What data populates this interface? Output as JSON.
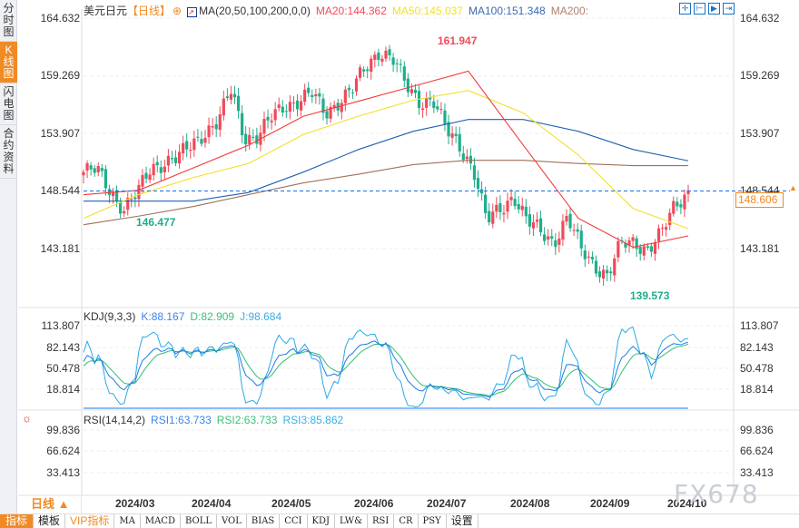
{
  "sidebar": {
    "tabs": [
      "分时图",
      "K线图",
      "闪电图",
      "合约资料"
    ],
    "active": 1
  },
  "header": {
    "symbol": "美元日元",
    "period_tag": "【日线】",
    "ma_label": "MA(20,50,100,200,0,0)",
    "ma20": "MA20:144.362",
    "ma50": "MA50:145.037",
    "ma100": "MA100:151.348",
    "ma200": "MA200:"
  },
  "colors": {
    "up": "#f04a5a",
    "down": "#1fae8a",
    "ma20": "#f03a3a",
    "ma50": "#f2e02a",
    "ma100": "#2060b0",
    "ma200": "#a0705a",
    "k": "#1e7be6",
    "d": "#2fbf71",
    "j": "#2aa8e6",
    "accent": "#f08a24"
  },
  "price_axis": [
    "164.632",
    "159.269",
    "153.907",
    "148.544",
    "143.181"
  ],
  "current_price": "148.606",
  "annotations": {
    "high": "161.947",
    "low_left": "146.477",
    "low_right": "139.573"
  },
  "kdj": {
    "label": "KDJ(9,3,3)",
    "k": "K:88.167",
    "d": "D:82.909",
    "j": "J:98.684",
    "axis": [
      "113.807",
      "82.143",
      "50.478",
      "18.814"
    ]
  },
  "rsi": {
    "label": "RSI(14,14,2)",
    "rsi1": "RSI1:63.733",
    "rsi2": "RSI2:63.733",
    "rsi3": "RSI3:85.862",
    "axis": [
      "99.836",
      "66.624",
      "33.413"
    ]
  },
  "period": "日线 ▲",
  "dates": [
    "2024/03",
    "2024/04",
    "2024/05",
    "2024/06",
    "2024/07",
    "2024/08",
    "2024/09",
    "2024/10"
  ],
  "tabs": [
    "指标",
    "模板",
    "VIP指标",
    "MA",
    "MACD",
    "BOLL",
    "VOL",
    "BIAS",
    "CCI",
    "KDJ",
    "LW&",
    "RSI",
    "CR",
    "PSY",
    "设置"
  ],
  "watermark": "FX678",
  "chart_data": {
    "type": "candlestick",
    "ylim": [
      139.0,
      165.5
    ],
    "close_samples": [
      150.3,
      150.4,
      148.6,
      146.9,
      148.2,
      150.7,
      151.3,
      151.5,
      152.8,
      154.1,
      154.9,
      157.9,
      153.6,
      153.6,
      155.3,
      156.6,
      157.0,
      157.5,
      155.8,
      157.0,
      157.9,
      160.0,
      161.7,
      160.8,
      158.3,
      157.0,
      157.0,
      154.1,
      152.8,
      150.7,
      145.6,
      146.9,
      148.2,
      145.6,
      144.8,
      143.9,
      146.0,
      143.1,
      141.8,
      140.6,
      143.5,
      143.9,
      143.1,
      144.4,
      147.3,
      148.6
    ],
    "ma20": [
      148.2,
      148.6,
      150.7,
      152.8,
      155.5,
      156.9,
      158.3,
      159.7,
      152.8,
      146.0,
      143.3,
      144.36
    ],
    "ma50": [
      146.0,
      148.2,
      149.8,
      151.1,
      153.8,
      155.5,
      157.0,
      157.9,
      155.8,
      151.9,
      146.9,
      145.04
    ],
    "ma100": [
      147.6,
      147.6,
      147.6,
      148.4,
      150.3,
      152.4,
      154.1,
      155.2,
      155.2,
      154.1,
      152.4,
      151.35
    ],
    "ma200": [
      145.4,
      146.2,
      147.1,
      148.2,
      149.3,
      150.1,
      151.0,
      151.4,
      151.4,
      151.1,
      150.9,
      150.9
    ],
    "reference_line": 148.544
  }
}
